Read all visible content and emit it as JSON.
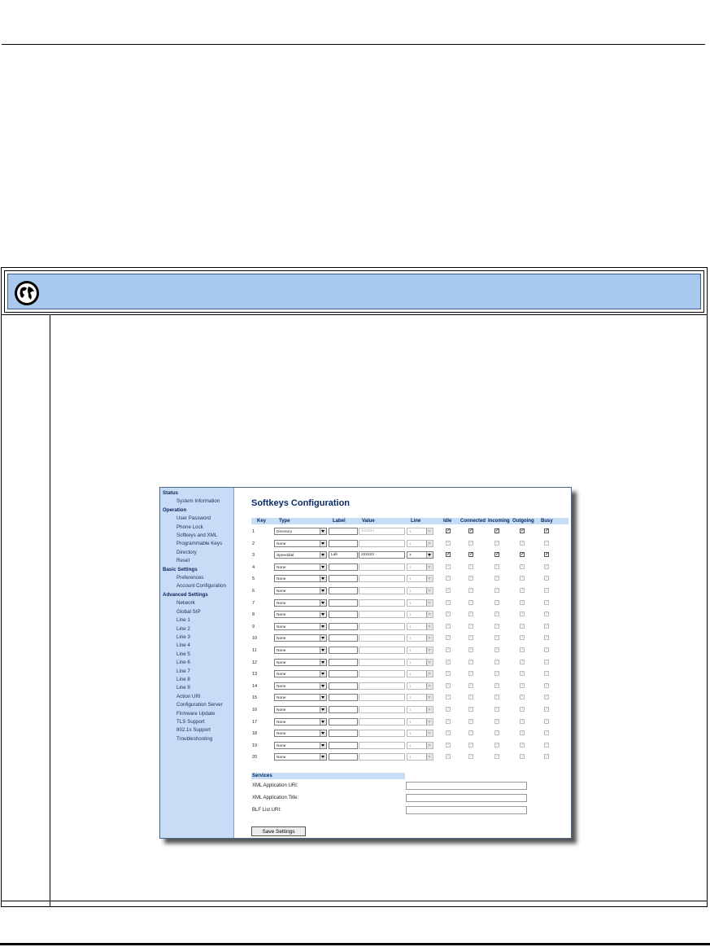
{
  "nav": {
    "sections": [
      {
        "heading": "Status",
        "items": [
          "System Information"
        ]
      },
      {
        "heading": "Operation",
        "items": [
          "User Password",
          "Phone Lock",
          "Softkeys and XML",
          "Programmable Keys",
          "Directory",
          "Reset"
        ]
      },
      {
        "heading": "Basic Settings",
        "items": [
          "Preferences",
          "Account Configuration"
        ]
      },
      {
        "heading": "Advanced Settings",
        "items": [
          "Network",
          "Global SIP",
          "Line 1",
          "Line 2",
          "Line 3",
          "Line 4",
          "Line 5",
          "Line 6",
          "Line 7",
          "Line 8",
          "Line 9",
          "Action URI",
          "Configuration Server",
          "Firmware Update",
          "TLS Support",
          "802.1x Support",
          "Troubleshooting"
        ]
      }
    ]
  },
  "page": {
    "title": "Softkeys Configuration"
  },
  "table": {
    "headers": {
      "key": "Key",
      "type": "Type",
      "label": "Label",
      "value": "Value",
      "line": "Line",
      "idle": "Idle",
      "connected": "Connected",
      "incoming": "Incoming",
      "outgoing": "Outgoing",
      "busy": "Busy"
    },
    "rows": [
      {
        "key": "1",
        "type": "Directory",
        "label": "",
        "value": "444444",
        "line": "1",
        "enabled": true,
        "value_disabled": true,
        "line_disabled": true,
        "states": [
          true,
          true,
          true,
          true,
          true
        ]
      },
      {
        "key": "2",
        "type": "None",
        "label": "",
        "value": "",
        "line": "1",
        "enabled": false,
        "states": [
          true,
          true,
          true,
          true,
          true
        ]
      },
      {
        "key": "3",
        "type": "Speeddial",
        "label": "Lab",
        "value": "222222",
        "line": "7",
        "enabled": true,
        "value_disabled": false,
        "line_disabled": false,
        "states": [
          true,
          true,
          true,
          true,
          true
        ]
      },
      {
        "key": "4",
        "type": "None",
        "label": "",
        "value": "",
        "line": "1",
        "enabled": false,
        "states": [
          true,
          true,
          true,
          true,
          true
        ]
      },
      {
        "key": "5",
        "type": "None",
        "label": "",
        "value": "",
        "line": "1",
        "enabled": false,
        "states": [
          true,
          true,
          true,
          true,
          true
        ]
      },
      {
        "key": "6",
        "type": "None",
        "label": "",
        "value": "",
        "line": "1",
        "enabled": false,
        "states": [
          true,
          true,
          true,
          true,
          true
        ]
      },
      {
        "key": "7",
        "type": "None",
        "label": "",
        "value": "",
        "line": "1",
        "enabled": false,
        "states": [
          true,
          true,
          true,
          true,
          true
        ]
      },
      {
        "key": "8",
        "type": "None",
        "label": "",
        "value": "",
        "line": "1",
        "enabled": false,
        "states": [
          true,
          true,
          true,
          true,
          true
        ]
      },
      {
        "key": "9",
        "type": "None",
        "label": "",
        "value": "",
        "line": "1",
        "enabled": false,
        "states": [
          true,
          true,
          true,
          true,
          true
        ]
      },
      {
        "key": "10",
        "type": "None",
        "label": "",
        "value": "",
        "line": "1",
        "enabled": false,
        "states": [
          true,
          true,
          true,
          true,
          true
        ]
      },
      {
        "key": "11",
        "type": "None",
        "label": "",
        "value": "",
        "line": "1",
        "enabled": false,
        "states": [
          true,
          true,
          true,
          true,
          true
        ]
      },
      {
        "key": "12",
        "type": "None",
        "label": "",
        "value": "",
        "line": "1",
        "enabled": false,
        "states": [
          true,
          true,
          true,
          true,
          true
        ]
      },
      {
        "key": "13",
        "type": "None",
        "label": "",
        "value": "",
        "line": "1",
        "enabled": false,
        "states": [
          true,
          true,
          true,
          true,
          true
        ]
      },
      {
        "key": "14",
        "type": "None",
        "label": "",
        "value": "",
        "line": "1",
        "enabled": false,
        "states": [
          true,
          true,
          true,
          true,
          true
        ]
      },
      {
        "key": "15",
        "type": "None",
        "label": "",
        "value": "",
        "line": "1",
        "enabled": false,
        "states": [
          true,
          true,
          true,
          true,
          true
        ]
      },
      {
        "key": "16",
        "type": "None",
        "label": "",
        "value": "",
        "line": "1",
        "enabled": false,
        "states": [
          true,
          true,
          true,
          true,
          true
        ]
      },
      {
        "key": "17",
        "type": "None",
        "label": "",
        "value": "",
        "line": "1",
        "enabled": false,
        "states": [
          true,
          true,
          true,
          true,
          true
        ]
      },
      {
        "key": "18",
        "type": "None",
        "label": "",
        "value": "",
        "line": "1",
        "enabled": false,
        "states": [
          true,
          true,
          true,
          true,
          true
        ]
      },
      {
        "key": "19",
        "type": "None",
        "label": "",
        "value": "",
        "line": "1",
        "enabled": false,
        "states": [
          true,
          true,
          true,
          true,
          true
        ]
      },
      {
        "key": "20",
        "type": "None",
        "label": "",
        "value": "",
        "line": "1",
        "enabled": false,
        "states": [
          true,
          true,
          true,
          true,
          true
        ]
      }
    ]
  },
  "services": {
    "title": "Services",
    "fields": [
      {
        "label": "XML Application URI:",
        "value": ""
      },
      {
        "label": "XML Application Title:",
        "value": ""
      },
      {
        "label": "BLF List URI:",
        "value": ""
      }
    ]
  },
  "buttons": {
    "save": "Save Settings"
  },
  "colors": {
    "banner": "#a9c8ee",
    "nav": "#c7dcf5",
    "title": "#0a2a66"
  }
}
